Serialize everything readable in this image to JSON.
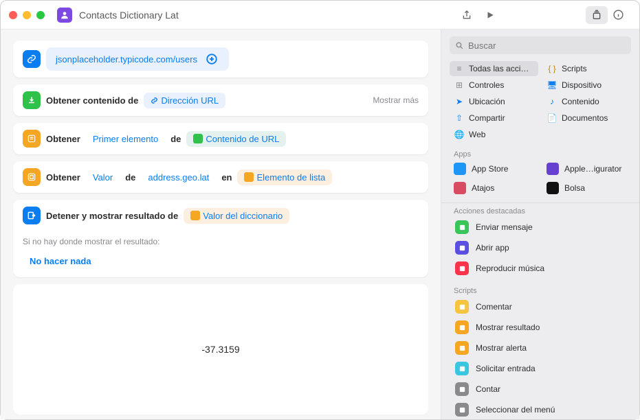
{
  "window": {
    "title": "Contacts Dictionary Lat"
  },
  "url_action": {
    "url": "jsonplaceholder.typicode.com/users"
  },
  "actions": {
    "get_contents": {
      "label": "Obtener contenido de",
      "param": "Dirección URL",
      "show_more": "Mostrar más"
    },
    "get_first": {
      "label_a": "Obtener",
      "param_a": "Primer elemento",
      "label_b": "de",
      "param_b": "Contenido de URL"
    },
    "get_value": {
      "label_a": "Obtener",
      "param_a": "Valor",
      "label_b": "de",
      "param_b": "address.geo.lat",
      "label_c": "en",
      "param_c": "Elemento de lista"
    },
    "stop": {
      "label": "Detener y mostrar resultado de",
      "param": "Valor del diccionario",
      "sub_label": "Si no hay donde mostrar el resultado:",
      "sub_value": "No hacer nada"
    }
  },
  "result": "-37.3159",
  "sidebar": {
    "search_placeholder": "Buscar",
    "categories": [
      {
        "label": "Todas las acci…",
        "color": "#8a8a8e",
        "selected": true
      },
      {
        "label": "Scripts",
        "color": "#b98b00"
      },
      {
        "label": "Controles",
        "color": "#8a8a8e"
      },
      {
        "label": "Dispositivo",
        "color": "#0a7df1"
      },
      {
        "label": "Ubicación",
        "color": "#0a7df1"
      },
      {
        "label": "Contenido",
        "color": "#0a7df1"
      },
      {
        "label": "Compartir",
        "color": "#0a7df1"
      },
      {
        "label": "Documentos",
        "color": "#0a7df1"
      },
      {
        "label": "Web",
        "color": "#0a7df1"
      }
    ],
    "apps_label": "Apps",
    "apps": [
      {
        "label": "App Store",
        "color": "#1e96f6"
      },
      {
        "label": "Apple…igurator",
        "color": "#6840d1"
      },
      {
        "label": "Atajos",
        "color": "#d74b63"
      },
      {
        "label": "Bolsa",
        "color": "#111"
      }
    ],
    "featured_label": "Acciones destacadas",
    "featured": [
      {
        "label": "Enviar mensaje",
        "color": "#39c558"
      },
      {
        "label": "Abrir app",
        "color": "#5b4fe0"
      },
      {
        "label": "Reproducir música",
        "color": "#f9334a"
      }
    ],
    "scripts_label": "Scripts",
    "scripts": [
      {
        "label": "Comentar",
        "color": "#f5c542"
      },
      {
        "label": "Mostrar resultado",
        "color": "#f5a623"
      },
      {
        "label": "Mostrar alerta",
        "color": "#f5a623"
      },
      {
        "label": "Solicitar entrada",
        "color": "#3bc6e0"
      },
      {
        "label": "Contar",
        "color": "#8a8a8e"
      },
      {
        "label": "Seleccionar del menú",
        "color": "#8a8a8e"
      }
    ]
  }
}
